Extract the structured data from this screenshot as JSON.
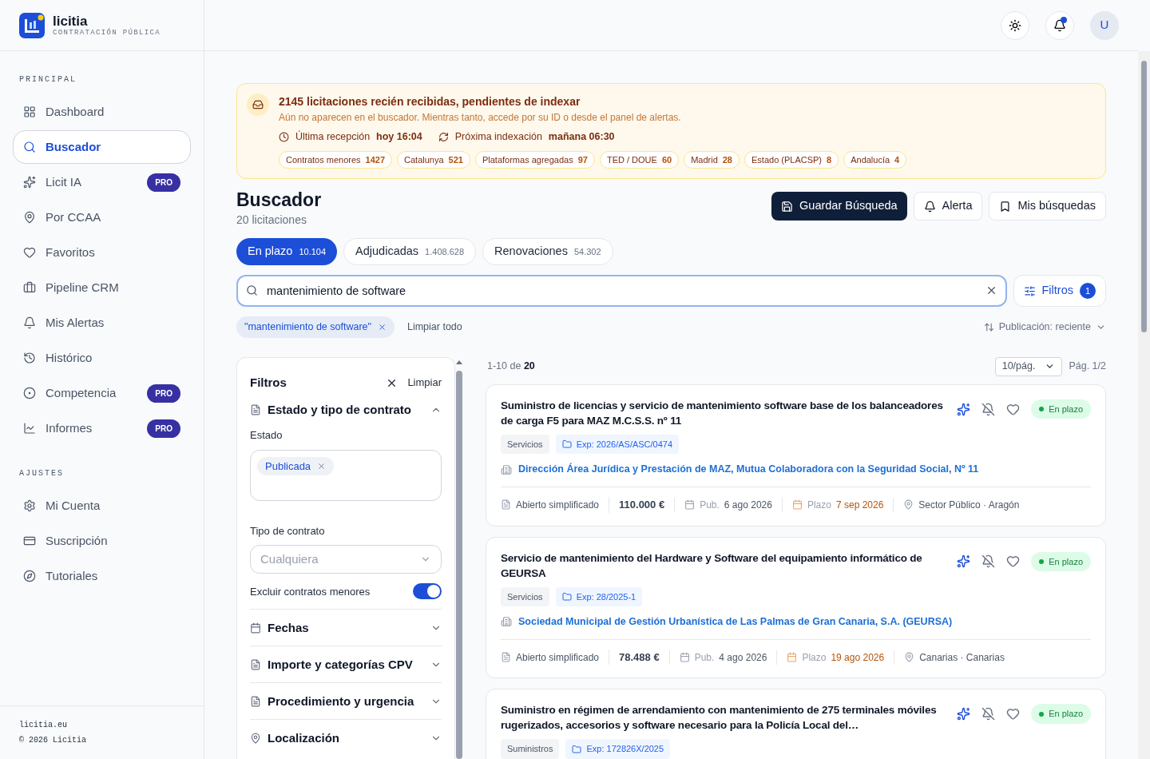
{
  "brand": {
    "name": "licitia",
    "tagline": "CONTRATACIÓN PÚBLICA"
  },
  "sidebar": {
    "sections": [
      {
        "heading": "PRINCIPAL",
        "items": [
          {
            "label": "Dashboard",
            "selected": false
          },
          {
            "label": "Buscador",
            "selected": true
          },
          {
            "label": "Licit IA",
            "selected": false,
            "badge": "PRO"
          },
          {
            "label": "Por CCAA",
            "selected": false
          },
          {
            "label": "Favoritos",
            "selected": false
          },
          {
            "label": "Pipeline CRM",
            "selected": false
          },
          {
            "label": "Mis Alertas",
            "selected": false
          },
          {
            "label": "Histórico",
            "selected": false
          },
          {
            "label": "Competencia",
            "selected": false,
            "badge": "PRO"
          },
          {
            "label": "Informes",
            "selected": false,
            "badge": "PRO"
          }
        ]
      },
      {
        "heading": "AJUSTES",
        "items": [
          {
            "label": "Mi Cuenta",
            "selected": false
          },
          {
            "label": "Suscripción",
            "selected": false
          },
          {
            "label": "Tutoriales",
            "selected": false
          }
        ]
      }
    ],
    "footer": {
      "site": "licitia.eu",
      "copyright": "© 2026 Licitia"
    }
  },
  "header": {
    "avatar": "U",
    "unread": true
  },
  "alert": {
    "title": "2145 licitaciones recién recibidas, pendientes de indexar",
    "description": "Aún no aparecen en el buscador. Mientras tanto, accede por su ID o desde el panel de alertas.",
    "last_label": "Última recepción",
    "last_value": "hoy 16:04",
    "next_label": "Próxima indexación",
    "next_value": "mañana 06:30",
    "sources": [
      {
        "label": "Contratos menores",
        "count": "1427"
      },
      {
        "label": "Catalunya",
        "count": "521"
      },
      {
        "label": "Plataformas agregadas",
        "count": "97"
      },
      {
        "label": "TED / DOUE",
        "count": "60"
      },
      {
        "label": "Madrid",
        "count": "28"
      },
      {
        "label": "Estado (PLACSP)",
        "count": "8"
      },
      {
        "label": "Andalucía",
        "count": "4"
      }
    ]
  },
  "page": {
    "title": "Buscador",
    "subtitle": "20 licitaciones"
  },
  "actions": [
    {
      "label": "Guardar Búsqueda",
      "kind": "primary"
    },
    {
      "label": "Alerta",
      "kind": "secondary"
    },
    {
      "label": "Mis búsquedas",
      "kind": "secondary"
    }
  ],
  "tabs": [
    {
      "label": "En plazo",
      "count": "10.104",
      "selected": true
    },
    {
      "label": "Adjudicadas",
      "count": "1.408.628",
      "selected": false
    },
    {
      "label": "Renovaciones",
      "count": "54.302",
      "selected": false
    }
  ],
  "search": {
    "value": "mantenimiento de software"
  },
  "filters_button": {
    "label": "Filtros",
    "count": "1"
  },
  "chips": [
    {
      "label": "\"mantenimiento de software\""
    }
  ],
  "clear_all": "Limpiar todo",
  "sort": {
    "label": "Publicación: reciente"
  },
  "filter_panel": {
    "title": "Filtros",
    "clear": "Limpiar",
    "sections": [
      {
        "title": "Estado y tipo de contrato",
        "expanded": true
      },
      {
        "title": "Fechas",
        "expanded": false
      },
      {
        "title": "Importe y categorías CPV",
        "expanded": false
      },
      {
        "title": "Procedimiento y urgencia",
        "expanded": false
      },
      {
        "title": "Localización",
        "expanded": false
      }
    ],
    "estado_label": "Estado",
    "estado_tags": [
      "Publicada"
    ],
    "tipo_label": "Tipo de contrato",
    "tipo_placeholder": "Cualquiera",
    "toggle": {
      "label": "Excluir contratos menores",
      "on": true
    }
  },
  "results": {
    "range": "1-10 de",
    "total": "20",
    "per_page": "10/pág.",
    "page": "Pág. 1/2"
  },
  "cards": [
    {
      "title": "Suministro de licencias y servicio de mantenimiento software base de los balanceadores de carga F5 para MAZ M.C.S.S. nº 11",
      "status": {
        "label": "En plazo",
        "kind": "open"
      },
      "category": "Servicios",
      "file": "Exp: 2026/AS/ASC/0474",
      "organization": "Dirección Área Jurídica y Prestación de MAZ, Mutua Colaboradora con la Seguridad Social, Nº 11",
      "procedure": "Abierto simplificado",
      "amount": "110.000 €",
      "pub_label": "Pub.",
      "pub_date": "6 ago 2026",
      "deadline_label": "Plazo",
      "deadline_date": "7 sep 2026",
      "location": "Sector Público · Aragón"
    },
    {
      "title": "Servicio de mantenimiento del Hardware y Software del equipamiento informático de GEURSA",
      "status": {
        "label": "En plazo",
        "kind": "open"
      },
      "category": "Servicios",
      "file": "Exp: 28/2025-1",
      "organization": "Sociedad Municipal de Gestión Urbanística de Las Palmas de Gran Canaria, S.A. (GEURSA)",
      "procedure": "Abierto simplificado",
      "amount": "78.488 €",
      "pub_label": "Pub.",
      "pub_date": "4 ago 2026",
      "deadline_label": "Plazo",
      "deadline_date": "19 ago 2026",
      "location": "Canarias · Canarias"
    },
    {
      "title": "Suministro en régimen de arrendamiento con mantenimiento de 275 terminales móviles rugerizados, accesorios y software necesario para la Policía Local del…",
      "status": {
        "label": "En plazo",
        "kind": "open"
      },
      "category": "Suministros",
      "file": "Exp: 172826X/2025"
    }
  ]
}
